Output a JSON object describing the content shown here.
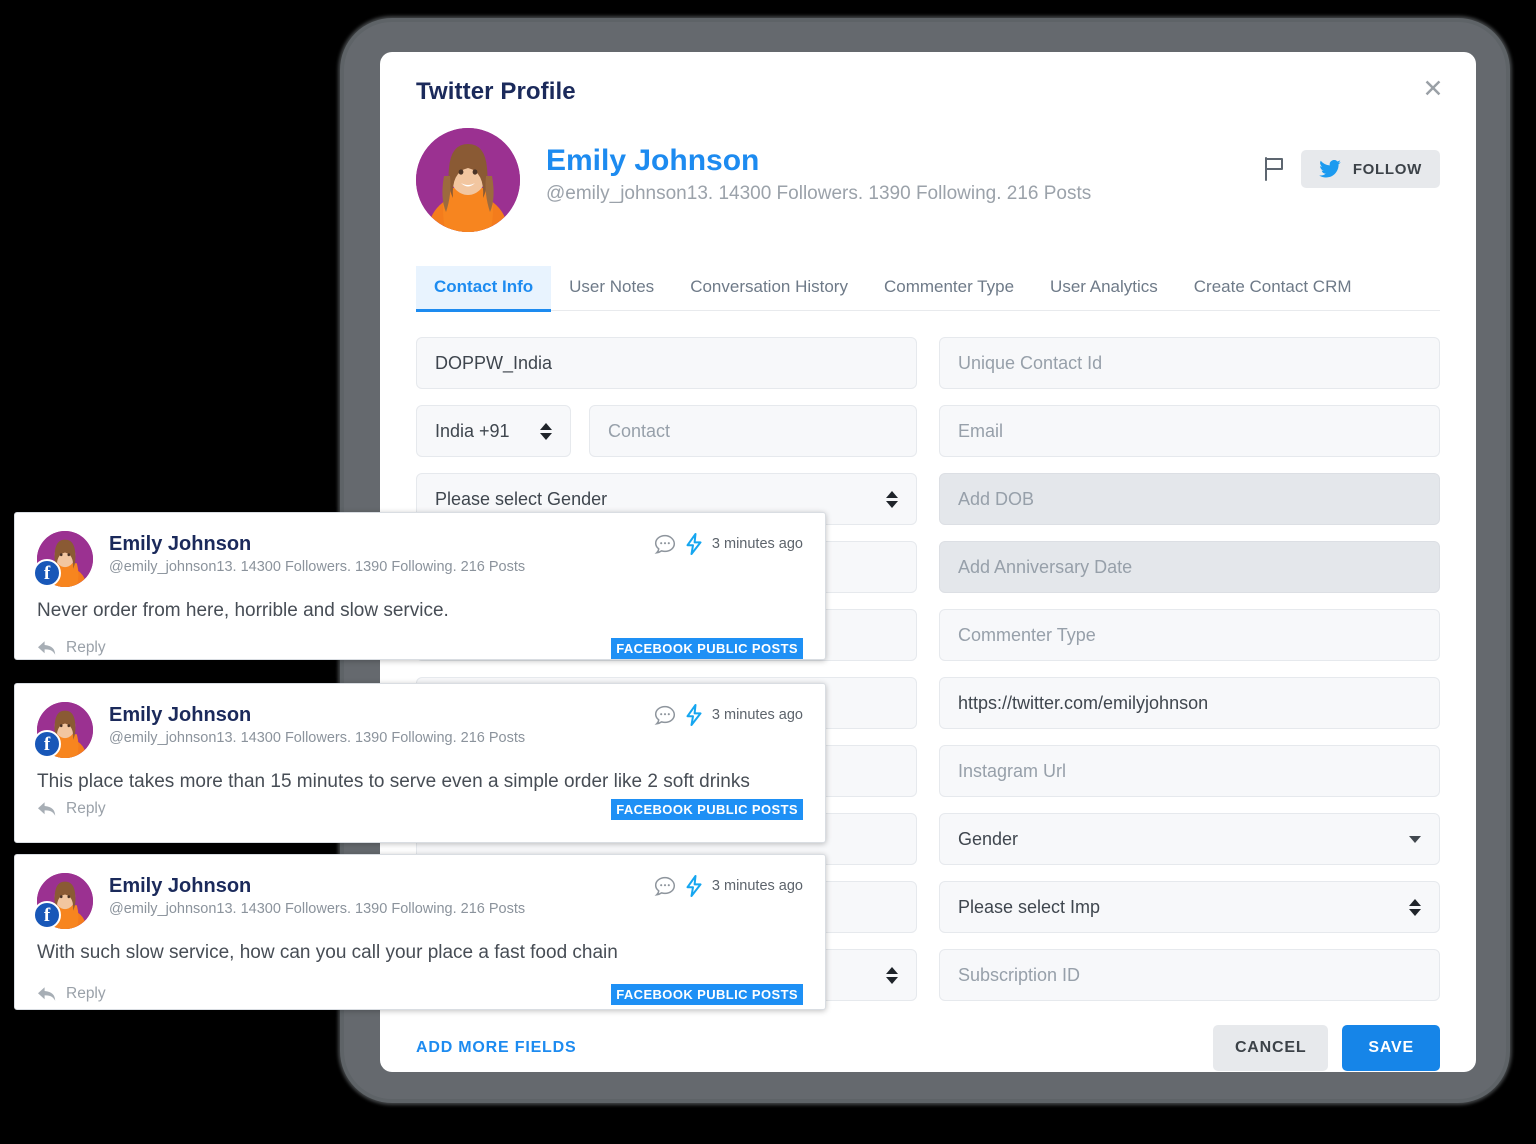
{
  "modal": {
    "title": "Twitter Profile",
    "close_icon": "close-icon"
  },
  "profile": {
    "name": "Emily Johnson",
    "sub": "@emily_johnson13. 14300 Followers. 1390 Following. 216 Posts",
    "flag_icon": "flag-icon",
    "follow_label": "FOLLOW",
    "twitter_icon": "twitter-bird-icon"
  },
  "tabs": [
    {
      "label": "Contact Info",
      "active": true
    },
    {
      "label": "User Notes",
      "active": false
    },
    {
      "label": "Conversation History",
      "active": false
    },
    {
      "label": "Commenter Type",
      "active": false
    },
    {
      "label": "User Analytics",
      "active": false
    },
    {
      "label": "Create Contact CRM",
      "active": false
    }
  ],
  "form": {
    "left": {
      "name_value": "DOPPW_India",
      "country_value": "India +91",
      "contact_placeholder": "Contact",
      "gender_select_value": "Please select Gender"
    },
    "right": [
      {
        "text": "Unique Contact Id",
        "filled": false,
        "shaded": false,
        "control": "none"
      },
      {
        "text": "Email",
        "filled": false,
        "shaded": false,
        "control": "none"
      },
      {
        "text": "Add DOB",
        "filled": false,
        "shaded": true,
        "control": "none"
      },
      {
        "text": "Add Anniversary Date",
        "filled": false,
        "shaded": true,
        "control": "none"
      },
      {
        "text": "Commenter Type",
        "filled": false,
        "shaded": false,
        "control": "none"
      },
      {
        "text": "https://twitter.com/emilyjohnson",
        "filled": true,
        "shaded": false,
        "control": "none"
      },
      {
        "text": "Instagram Url",
        "filled": false,
        "shaded": false,
        "control": "none"
      },
      {
        "text": "Gender",
        "filled": true,
        "shaded": false,
        "control": "caret"
      },
      {
        "text": "Please select Imp",
        "filled": true,
        "shaded": false,
        "control": "stepper"
      },
      {
        "text": "Subscription ID",
        "filled": false,
        "shaded": false,
        "control": "none"
      }
    ]
  },
  "footer": {
    "add_more_fields": "ADD MORE FIELDS",
    "cancel_label": "CANCEL",
    "save_label": "SAVE"
  },
  "comments": [
    {
      "name": "Emily Johnson",
      "sub": "@emily_johnson13. 14300 Followers. 1390 Following. 216 Posts",
      "ago": "3 minutes ago",
      "body": "Never order from here, horrible and slow service.",
      "reply_label": "Reply",
      "source": "FACEBOOK PUBLIC POSTS"
    },
    {
      "name": "Emily Johnson",
      "sub": "@emily_johnson13. 14300 Followers. 1390 Following. 216 Posts",
      "ago": "3 minutes ago",
      "body": "This place takes more than 15 minutes to serve even a simple order like 2 soft drinks",
      "reply_label": "Reply",
      "source": "FACEBOOK PUBLIC POSTS"
    },
    {
      "name": "Emily Johnson",
      "sub": "@emily_johnson13. 14300 Followers. 1390 Following. 216 Posts",
      "ago": "3 minutes ago",
      "body": "With such slow service, how can you call your place a fast food chain",
      "reply_label": "Reply",
      "source": "FACEBOOK PUBLIC POSTS"
    }
  ],
  "colors": {
    "accent_blue": "#1d8bf0",
    "save_blue": "#1685e8",
    "badge_blue": "#1e90f5",
    "title_navy": "#1b2a5b",
    "muted_gray": "#9ba2aa",
    "avatar_bg": "#9b3191",
    "facebook_blue": "#1857b8"
  }
}
